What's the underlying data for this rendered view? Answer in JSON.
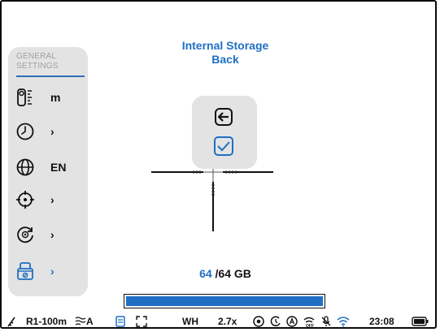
{
  "header": {
    "line1": "Internal Storage",
    "line2": "Back"
  },
  "sidebar": {
    "title_line1": "GENERAL",
    "title_line2": "SETTINGS",
    "items": [
      {
        "icon": "unit-icon",
        "value": "m"
      },
      {
        "icon": "clock-icon",
        "value": "›"
      },
      {
        "icon": "globe-icon",
        "value": "EN"
      },
      {
        "icon": "crosshair-icon",
        "value": "›"
      },
      {
        "icon": "gear-cycle-icon",
        "value": "›"
      },
      {
        "icon": "storage-icon",
        "value": "›",
        "active": true
      }
    ]
  },
  "dialog": {
    "options": [
      "back-arrow-icon",
      "checkbox-icon"
    ]
  },
  "storage": {
    "used": "64",
    "total": "/64 GB",
    "fill_fraction": 1.0
  },
  "statusbar": {
    "profile": "R1-100m",
    "mode": "A",
    "palette": "WH",
    "zoom": "2.7x",
    "time": "23:08"
  },
  "colors": {
    "accent": "#1f6fc5",
    "panel": "#e3e3e3"
  }
}
